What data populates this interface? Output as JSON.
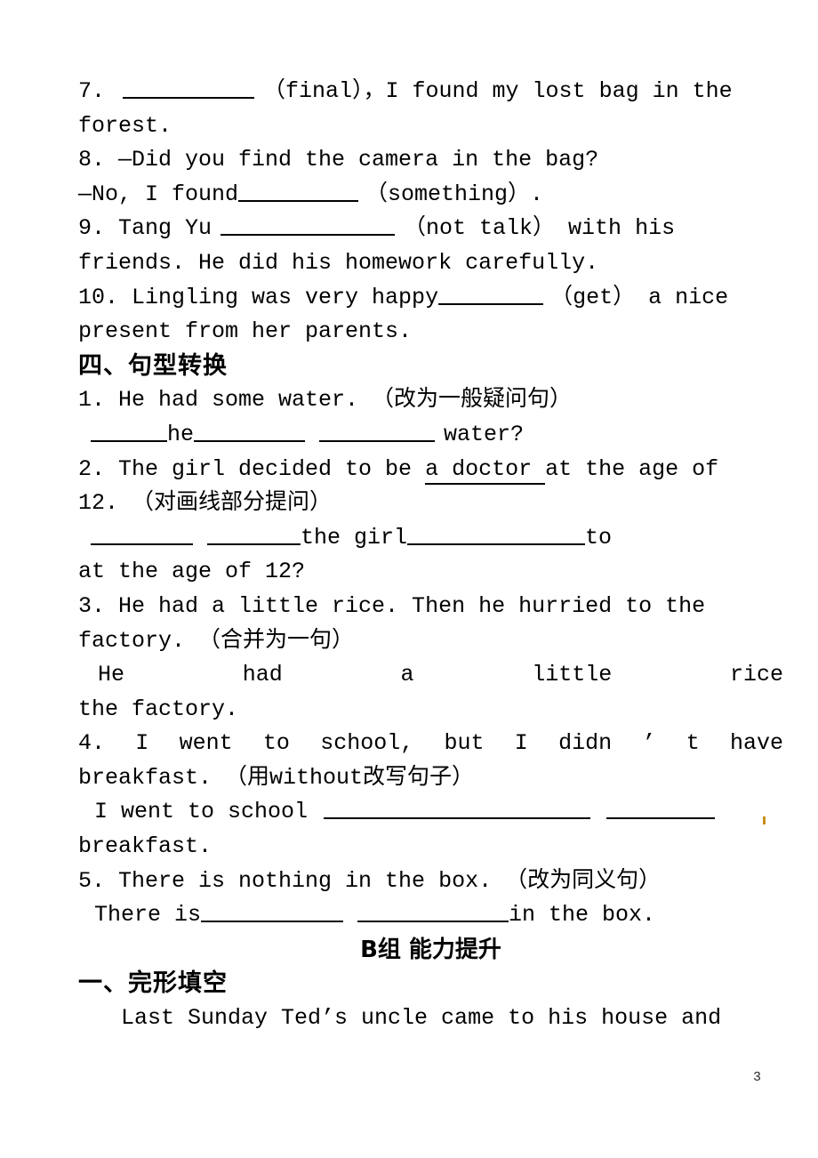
{
  "document": {
    "page_number": "3",
    "section_b_title": "B组  能力提升"
  },
  "exercises": {
    "fill_in_blanks_tail": [
      {
        "number": "7.",
        "line1_before_blank": "7.",
        "line1_after_blank": "（final），I found my lost bag in the",
        "line2": "forest."
      },
      {
        "number": "8.",
        "line1": "8. —Did you find the camera in the bag?",
        "line2_before_blank": "—No, I found",
        "line2_after_blank": "（something）."
      },
      {
        "number": "9.",
        "line1_before_blank": "9. Tang Yu",
        "line1_after_blank": "（not talk） with his",
        "line2": "friends. He did his homework carefully."
      },
      {
        "number": "10.",
        "line1_before_blank": "10. Lingling was very happy",
        "line1_after_blank": "（get） a nice",
        "line2": "present from her parents."
      }
    ],
    "section_four": {
      "heading": "四、句型转换",
      "items": [
        {
          "number": "1.",
          "prompt": "1. He had some water. （改为一般疑问句）",
          "answer_line_mid": "he",
          "answer_line_tail": "water?"
        },
        {
          "number": "2.",
          "prompt_part1": "2. The girl decided to be ",
          "prompt_underlined": "a doctor ",
          "prompt_part2": "at the age of",
          "prompt_line2": "12. （对画线部分提问）",
          "answer_mid": "the girl",
          "answer_tail": "to",
          "answer_line2": "at the age of 12?"
        },
        {
          "number": "3.",
          "prompt_line1": "3. He had a little rice. Then he hurried to the",
          "prompt_line2": "factory. （合并为一句）",
          "answer_words": [
            "He",
            "had",
            "a",
            "little",
            "rice"
          ],
          "answer_line2": "the factory."
        },
        {
          "number": "4.",
          "prompt_words": [
            "4.",
            "I",
            "went",
            "to",
            "school,",
            "but",
            "I",
            "didn",
            "’",
            "t",
            "have"
          ],
          "prompt_line2": "breakfast. （用without改写句子）",
          "answer_line1_prefix": "I went to school",
          "answer_line2": "breakfast."
        },
        {
          "number": "5.",
          "prompt": "5. There is nothing in the box. （改为同义句）",
          "answer_prefix": "There is",
          "answer_suffix": "in the box."
        }
      ]
    },
    "section_b": {
      "title": "B组  能力提升",
      "section_one": {
        "heading": "一、完形填空",
        "passage_line1": "Last Sunday Ted’s uncle came to his house and"
      }
    }
  }
}
